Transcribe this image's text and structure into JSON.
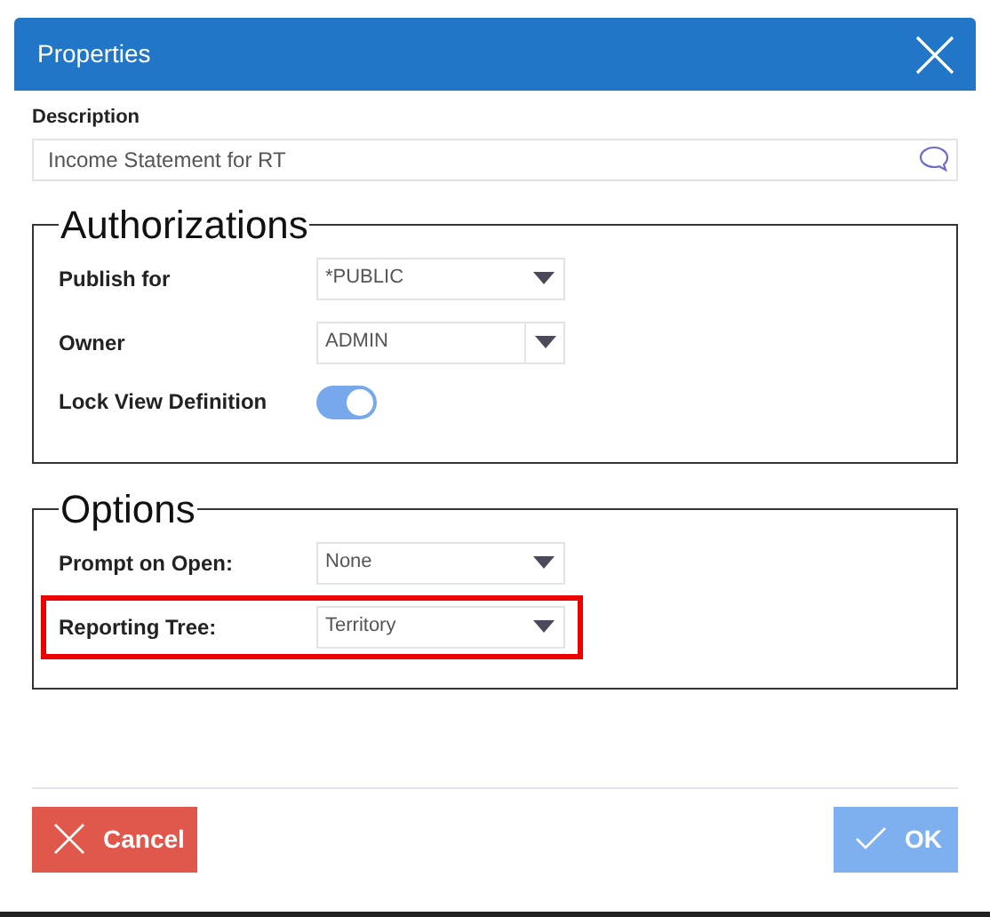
{
  "dialog": {
    "title": "Properties"
  },
  "description": {
    "label": "Description",
    "value": "Income Statement for RT"
  },
  "sections": [
    {
      "title": "Authorizations",
      "rows": [
        {
          "kind": "select",
          "label": "Publish for",
          "value": "*PUBLIC",
          "highlighted": false
        },
        {
          "kind": "combo",
          "label": "Owner",
          "value": "ADMIN",
          "highlighted": false
        },
        {
          "kind": "toggle",
          "label": "Lock View Definition",
          "on": true,
          "highlighted": false
        }
      ]
    },
    {
      "title": "Options",
      "rows": [
        {
          "kind": "select",
          "label": "Prompt on Open:",
          "value": "None",
          "highlighted": false
        },
        {
          "kind": "select",
          "label": "Reporting Tree:",
          "value": "Territory",
          "highlighted": true
        }
      ]
    }
  ],
  "buttons": [
    {
      "kind": "cancel",
      "label": "Cancel",
      "disabled": false
    },
    {
      "kind": "ok",
      "label": "OK",
      "disabled": true
    }
  ]
}
